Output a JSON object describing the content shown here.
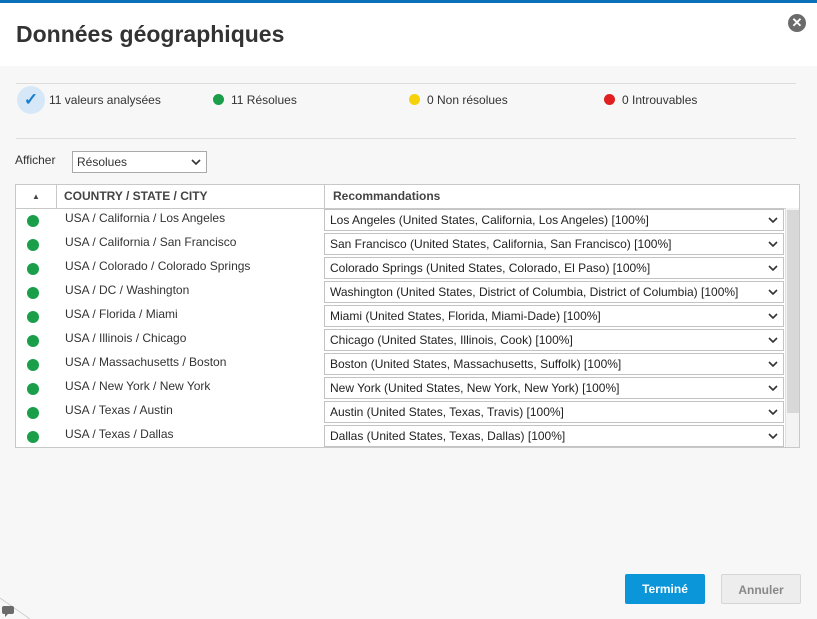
{
  "dialog": {
    "title": "Données géographiques",
    "close_icon": "close-circle-icon"
  },
  "summary": {
    "analyzed": "11 valeurs analysées",
    "resolved": "11 Résolues",
    "unresolved": "0 Non résolues",
    "not_found": "0 Introuvables",
    "colors": {
      "resolved": "#1a9e4a",
      "unresolved": "#f5d20a",
      "not_found": "#e02020",
      "check": "#1a7fd0"
    }
  },
  "filter": {
    "label": "Afficher",
    "value": "Résolues"
  },
  "table": {
    "sort_icon": "sort-ascending-icon",
    "columns": [
      "COUNTRY / STATE / CITY",
      "Recommandations"
    ],
    "rows": [
      {
        "location": "USA / California / Los Angeles",
        "recommendation": "Los Angeles (United States, California, Los Angeles) [100%]"
      },
      {
        "location": "USA / California / San Francisco",
        "recommendation": "San Francisco (United States, California, San Francisco) [100%]"
      },
      {
        "location": "USA / Colorado / Colorado Springs",
        "recommendation": "Colorado Springs (United States, Colorado, El Paso) [100%]"
      },
      {
        "location": "USA / DC / Washington",
        "recommendation": "Washington (United States, District of Columbia, District of Columbia) [100%]"
      },
      {
        "location": "USA / Florida / Miami",
        "recommendation": "Miami (United States, Florida, Miami-Dade) [100%]"
      },
      {
        "location": "USA / Illinois / Chicago",
        "recommendation": "Chicago (United States, Illinois, Cook) [100%]"
      },
      {
        "location": "USA / Massachusetts / Boston",
        "recommendation": "Boston (United States, Massachusetts, Suffolk) [100%]"
      },
      {
        "location": "USA / New York / New York",
        "recommendation": "New York (United States, New York, New York) [100%]"
      },
      {
        "location": "USA / Texas / Austin",
        "recommendation": "Austin (United States, Texas, Travis) [100%]"
      },
      {
        "location": "USA / Texas / Dallas",
        "recommendation": "Dallas (United States, Texas, Dallas) [100%]"
      }
    ]
  },
  "buttons": {
    "ok": "Terminé",
    "cancel": "Annuler"
  }
}
